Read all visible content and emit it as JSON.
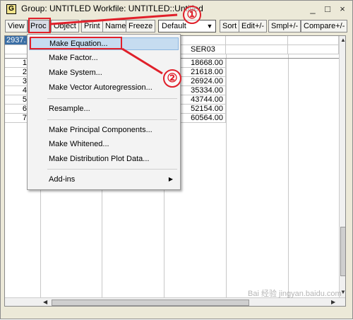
{
  "window": {
    "icon_letter": "G",
    "title": "Group: UNTITLED   Workfile: UNTITLED::Untitled",
    "controls": [
      "_",
      "□",
      "×"
    ]
  },
  "toolbar": {
    "buttons": [
      "View",
      "Proc",
      "Object",
      "Print",
      "Name",
      "Freeze"
    ],
    "view_select": "Default",
    "buttons_right": [
      "Sort",
      "Edit+/-",
      "Smpl+/-",
      "Compare+/-"
    ]
  },
  "grid": {
    "selected_cell": "2937.",
    "column_headers": [
      "",
      "",
      "SER03"
    ],
    "row_labels": [
      "1",
      "2",
      "3",
      "4",
      "5",
      "6",
      "7"
    ],
    "ser03_values": [
      "18668.00",
      "21618.00",
      "26924.00",
      "35334.00",
      "43744.00",
      "52154.00",
      "60564.00"
    ]
  },
  "menu": {
    "items": [
      "Make Equation...",
      "Make Factor...",
      "Make System...",
      "Make Vector Autoregression...",
      "Resample...",
      "Make Principal Components...",
      "Make Whitened...",
      "Make Distribution Plot Data...",
      "Add-ins"
    ],
    "highlighted_index": 0
  },
  "annotations": {
    "step1": "①",
    "step2": "②",
    "color": "#e0202a"
  },
  "watermark": "Bai 经验  jingyan.baidu.com"
}
